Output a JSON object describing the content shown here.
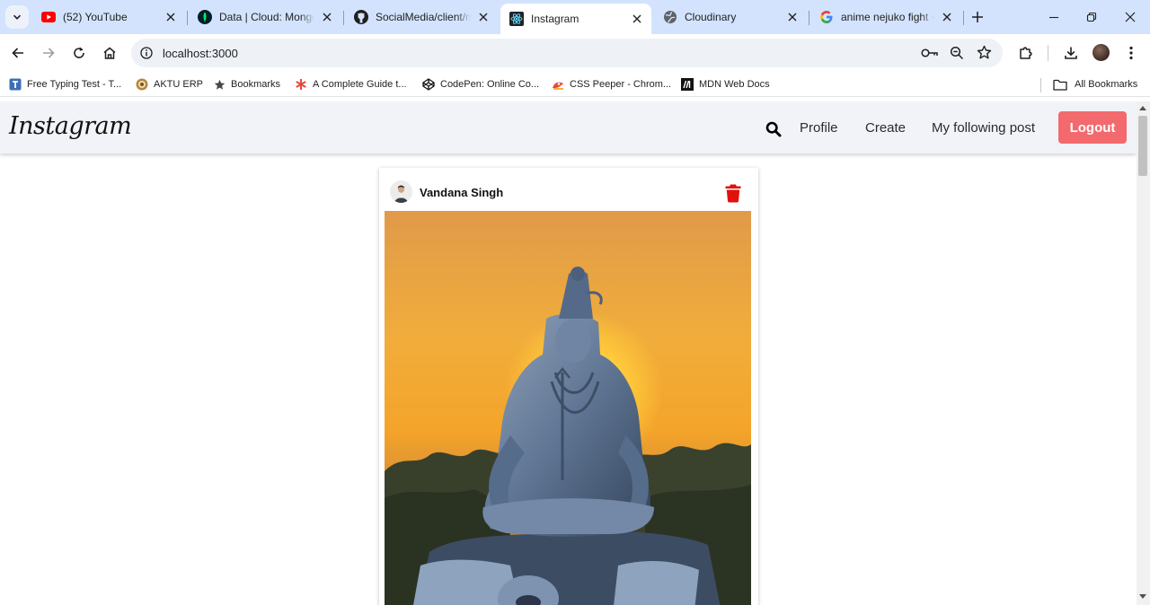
{
  "browser": {
    "tabs": [
      {
        "title": "(52) YouTube",
        "icon": "youtube-icon"
      },
      {
        "title": "Data | Cloud: MongoDB Cloud",
        "icon": "mongodb-icon"
      },
      {
        "title": "SocialMedia/client/my-app",
        "icon": "github-icon"
      },
      {
        "title": "Instagram",
        "icon": "react-icon",
        "active": true
      },
      {
        "title": "Cloudinary",
        "icon": "globe-icon"
      },
      {
        "title": "anime nejuko fight - Google Search",
        "icon": "google-icon"
      }
    ],
    "address": "localhost:3000",
    "bookmarks": [
      {
        "label": "Free Typing Test - T...",
        "icon": "typing-icon"
      },
      {
        "label": "AKTU ERP",
        "icon": "aktu-icon"
      },
      {
        "label": "Bookmarks",
        "icon": "star-icon"
      },
      {
        "label": "A Complete Guide t...",
        "icon": "asterisk-icon"
      },
      {
        "label": "CodePen: Online Co...",
        "icon": "codepen-icon"
      },
      {
        "label": "CSS Peeper - Chrom...",
        "icon": "csspeeper-icon"
      },
      {
        "label": "MDN Web Docs",
        "icon": "mdn-icon"
      }
    ],
    "all_bookmarks": "All Bookmarks"
  },
  "app": {
    "logo": "Instagram",
    "nav": {
      "profile": "Profile",
      "create": "Create",
      "following": "My following post",
      "logout": "Logout"
    },
    "colors": {
      "logout": "#f26a6e",
      "navbar": "#f1f3f8",
      "trash": "#e0120b"
    }
  },
  "post": {
    "username": "Vandana Singh",
    "image": "statue-at-sunset-photo"
  }
}
